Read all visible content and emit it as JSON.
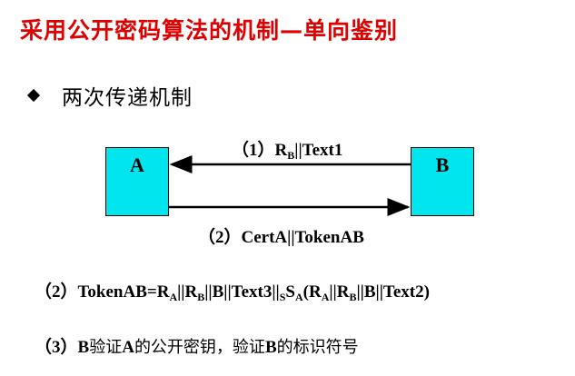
{
  "title": "采用公开密码算法的机制—单向鉴别",
  "bullet": "两次传递机制",
  "entities": {
    "a": "A",
    "b": "B"
  },
  "arrow1": {
    "prefix": "（1）",
    "r": "R",
    "r_sub": "B",
    "rest": "||Text1"
  },
  "arrow2": {
    "label": "（2）CertA||TokenAB"
  },
  "formula": {
    "prefix": "（2）TokenAB=",
    "parts": [
      {
        "t": "R"
      },
      {
        "sub": "A"
      },
      {
        "t": "||R"
      },
      {
        "sub": "B"
      },
      {
        "t": "||B||Text3||"
      },
      {
        "sub": "S"
      },
      {
        "t": "S"
      },
      {
        "sub": "A"
      },
      {
        "t": "(R"
      },
      {
        "sub": "A"
      },
      {
        "t": "||R"
      },
      {
        "sub": "B"
      },
      {
        "t": "||B||Text2)"
      }
    ]
  },
  "step3": {
    "prefix": "（3）",
    "b1": "B",
    "c1": "验证",
    "a1": "A",
    "c2": "的公开密钥，验证",
    "b2": "B",
    "c3": "的标识符号"
  },
  "colors": {
    "title": "#e00000",
    "box": "#00e5ee"
  }
}
